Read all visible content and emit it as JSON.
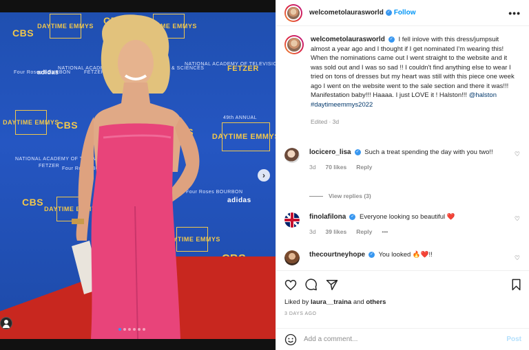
{
  "header": {
    "username": "welcometolaurasworld",
    "follow_label": "Follow",
    "more_label": "•••"
  },
  "caption": {
    "username": "welcometolaurasworld",
    "text": "I fell inlove with this dress/jumpsuit almost a year ago and I thought if I get nominated I'm wearing this! When the nominations came out I went straight to the website and it was sold out and I was so sad !! I couldn't find anything else to wear I tried on tons of dresses but my heart was still with this piece one week ago I went on the website went to the sale section and there it was!!! Manifestation baby!!! Haaaa. I just LOVE it ! Halston!!!",
    "mention": "@halston",
    "hashtag": "#daytimeemmys2022",
    "edited": "Edited · 3d"
  },
  "comments": [
    {
      "username": "locicero_lisa",
      "text": "Such a treat spending the day with you two!!",
      "age": "3d",
      "likes": "70 likes",
      "reply": "Reply",
      "view_replies": "View replies (3)"
    },
    {
      "username": "finolafilona",
      "text": "Everyone looking so beautiful ❤️",
      "age": "3d",
      "likes": "39 likes",
      "reply": "Reply",
      "more": "•••"
    },
    {
      "username": "thecourtneyhope",
      "text": "You looked 🔥❤️!!"
    }
  ],
  "liked_by": {
    "prefix": "Liked by",
    "user": "laura__traina",
    "and": "and",
    "others": "others"
  },
  "post_date": "3 DAYS AGO",
  "add_comment": {
    "placeholder": "Add a comment...",
    "post_label": "Post"
  },
  "photo": {
    "logos": [
      "CBS",
      "DAYTIME EMMYS",
      "FETZER",
      "adidas",
      "NATIONAL ACADEMY OF TELEVISION ARTS & SCIENCES",
      "Four Roses BOURBON",
      "49th ANNUAL"
    ],
    "slide_count": 6,
    "active_slide": 1
  },
  "colors": {
    "accent": "#0095f6",
    "text": "#262626",
    "muted": "#8e8e8e",
    "dress": "#e8447a",
    "backdrop": "#2151b8",
    "carpet": "#c8271f"
  }
}
